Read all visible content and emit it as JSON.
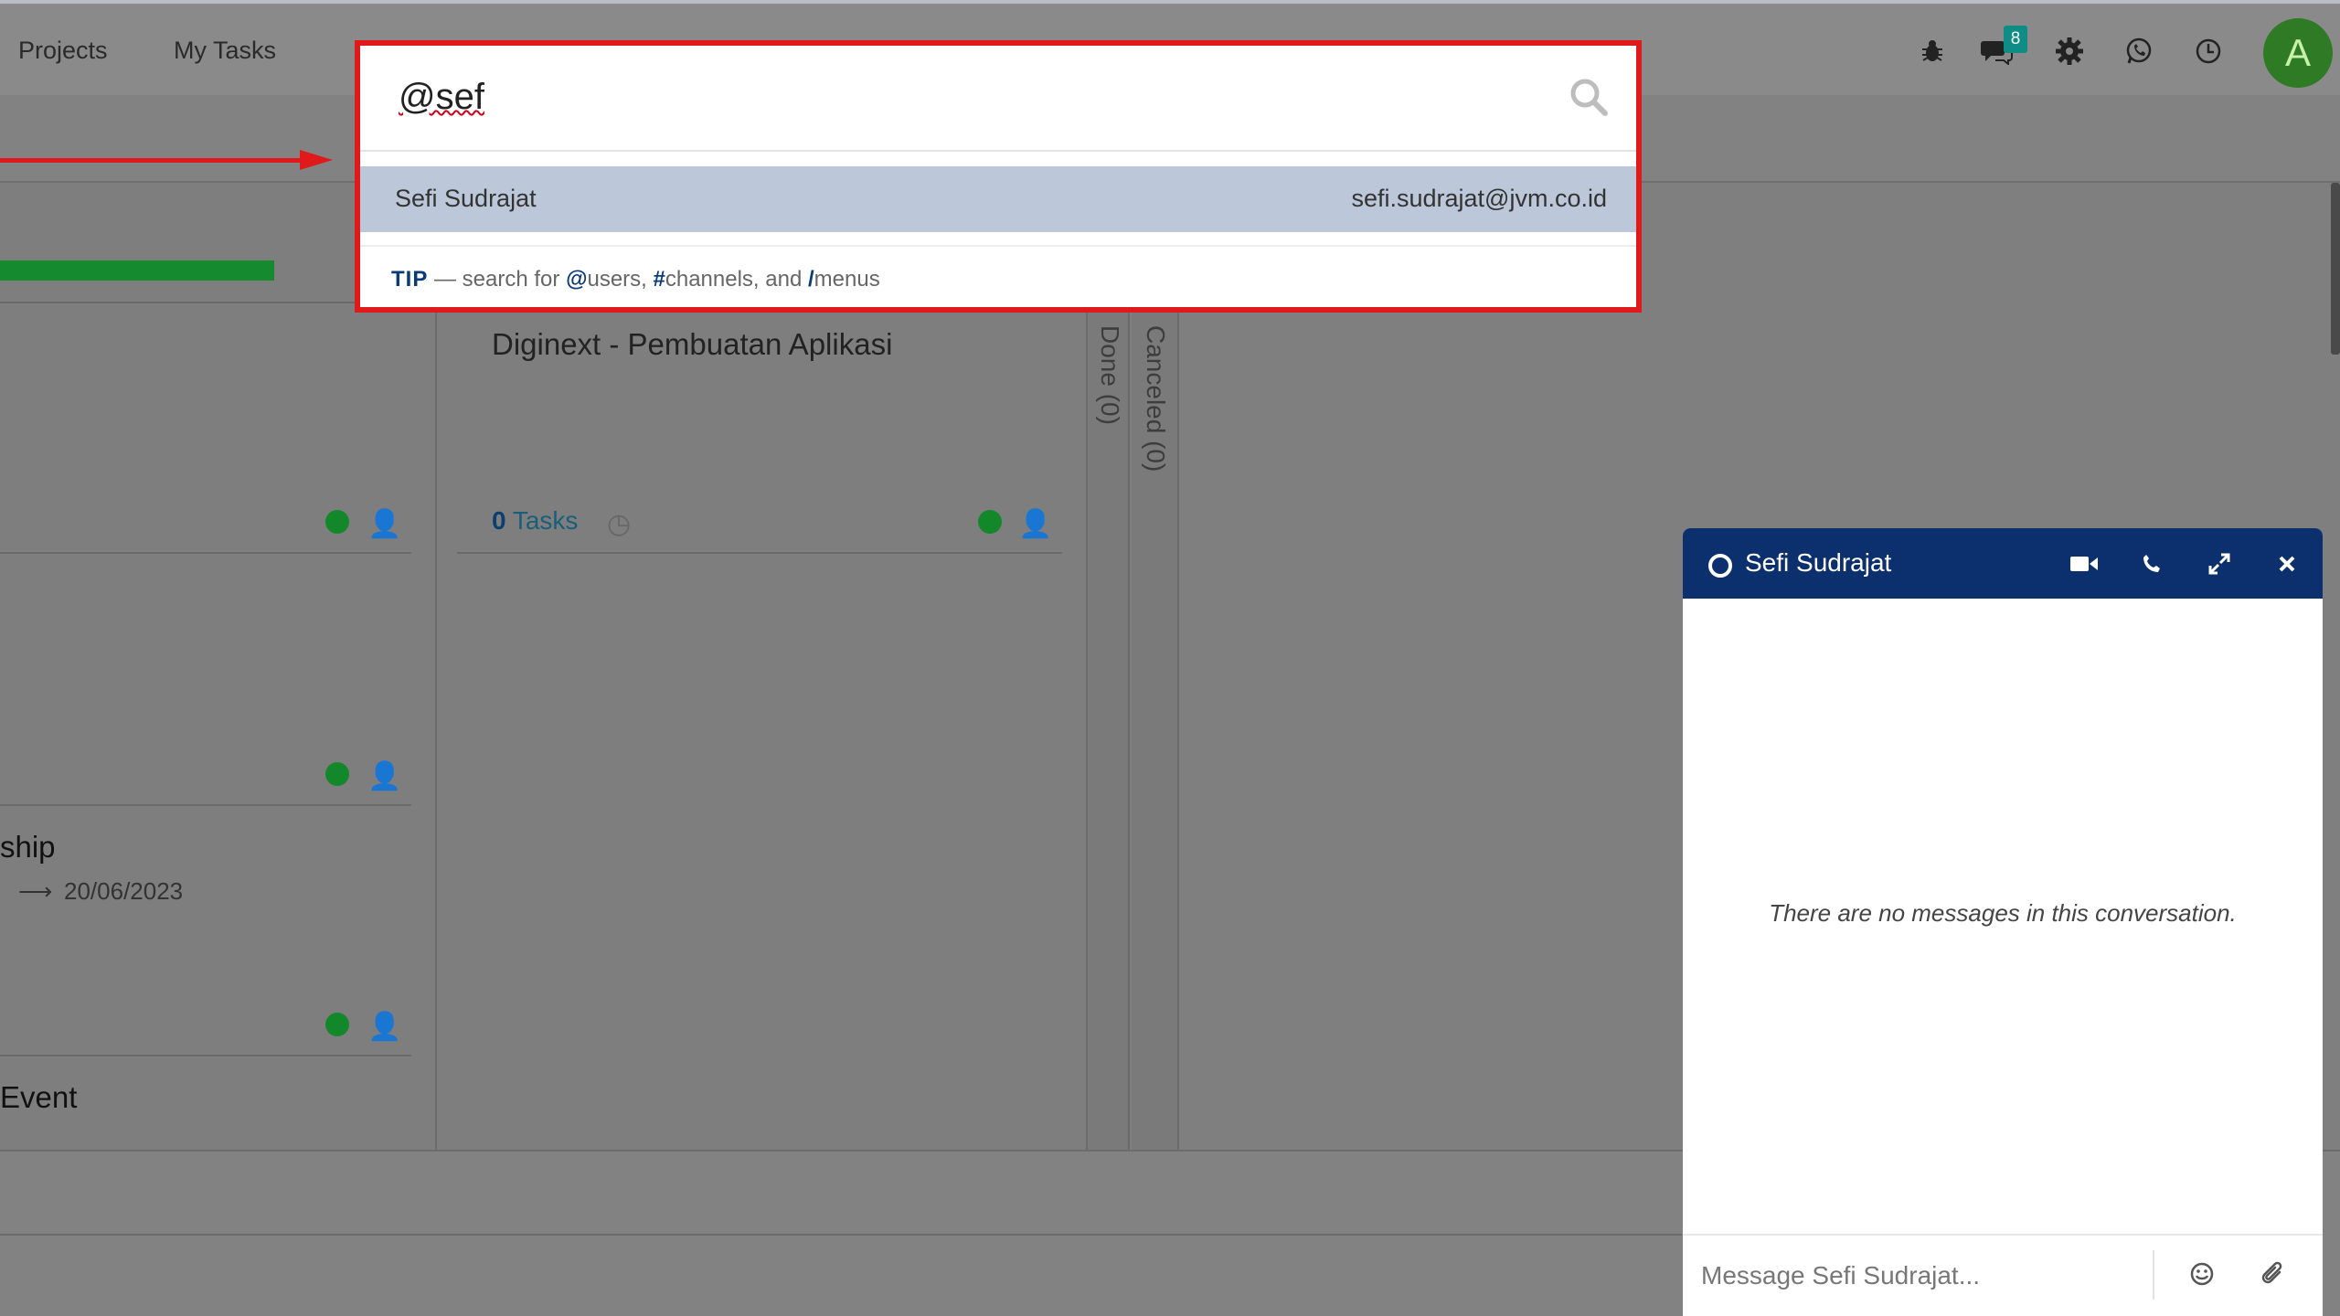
{
  "topbar": {
    "nav": [
      "Projects",
      "My Tasks"
    ],
    "icons": [
      "bug-icon",
      "chat-icon",
      "gear-icon",
      "whatsapp-icon",
      "clock-icon"
    ],
    "notif_count": "8",
    "avatar_letter": "A"
  },
  "search": {
    "query": "@sef",
    "results": [
      {
        "name": "Sefi Sudrajat",
        "email": "sefi.sudrajat@jvm.co.id"
      }
    ],
    "tip": {
      "label": "TIP",
      "p1": " — search for ",
      "k1": "@",
      "p2": "users, ",
      "k2": "#",
      "p3": "channels, and ",
      "k3": "/",
      "p4": "menus"
    }
  },
  "board": {
    "left_cards": [
      {
        "title": "ship",
        "date": "20/06/2023"
      },
      {
        "title": "Event"
      }
    ],
    "mid_card": {
      "title": "Diginext - Pembuatan Aplikasi",
      "tasks_count": "0",
      "tasks_label": " Tasks"
    },
    "stages": [
      "Done (0)",
      "Canceled (0)"
    ]
  },
  "chat": {
    "name": "Sefi Sudrajat",
    "empty_text": "There are no messages in this conversation.",
    "placeholder": "Message Sefi Sudrajat..."
  },
  "colors": {
    "accent": "#0c2f6d",
    "highlight_border": "#e01a1a",
    "status_green": "#13882a"
  }
}
